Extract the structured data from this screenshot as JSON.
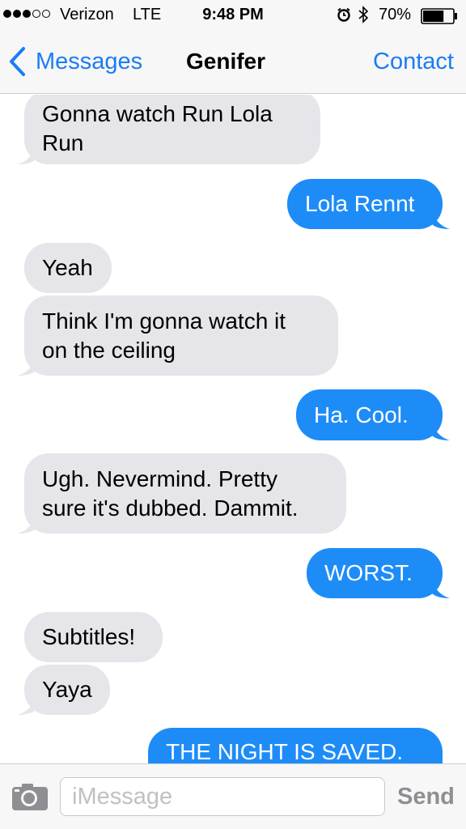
{
  "status_bar": {
    "signal_bars_filled": 3,
    "signal_bars_total": 5,
    "carrier": "Verizon",
    "network": "LTE",
    "time": "9:48 PM",
    "battery_percent": "70%",
    "battery_level": 0.7,
    "icons": [
      "alarm-icon",
      "bluetooth-icon",
      "battery-icon"
    ]
  },
  "nav": {
    "back_label": "Messages",
    "title": "Genifer",
    "contact_label": "Contact",
    "back_icon": "chevron-left-icon"
  },
  "messages": [
    {
      "from": "them",
      "text": "Gonna watch Run Lola\nRun"
    },
    {
      "from": "me",
      "text": "Lola Rennt"
    },
    {
      "from": "them",
      "text": "Yeah"
    },
    {
      "from": "them",
      "text": "Think I'm gonna watch it\non the ceiling"
    },
    {
      "from": "me",
      "text": "Ha. Cool."
    },
    {
      "from": "them",
      "text": "Ugh. Nevermind. Pretty\nsure it's dubbed. Dammit."
    },
    {
      "from": "me",
      "text": "WORST."
    },
    {
      "from": "them",
      "text": "Subtitles!"
    },
    {
      "from": "them",
      "text": "Yaya"
    },
    {
      "from": "me",
      "text": "THE NIGHT IS SAVED."
    }
  ],
  "input_bar": {
    "camera_icon": "camera-icon",
    "placeholder": "iMessage",
    "value": "",
    "send_label": "Send"
  },
  "colors": {
    "accent": "#1a7cf5",
    "outgoing_bubble": "#1e8cf7",
    "incoming_bubble": "#e5e5ea",
    "send_disabled": "#8e8e93"
  }
}
